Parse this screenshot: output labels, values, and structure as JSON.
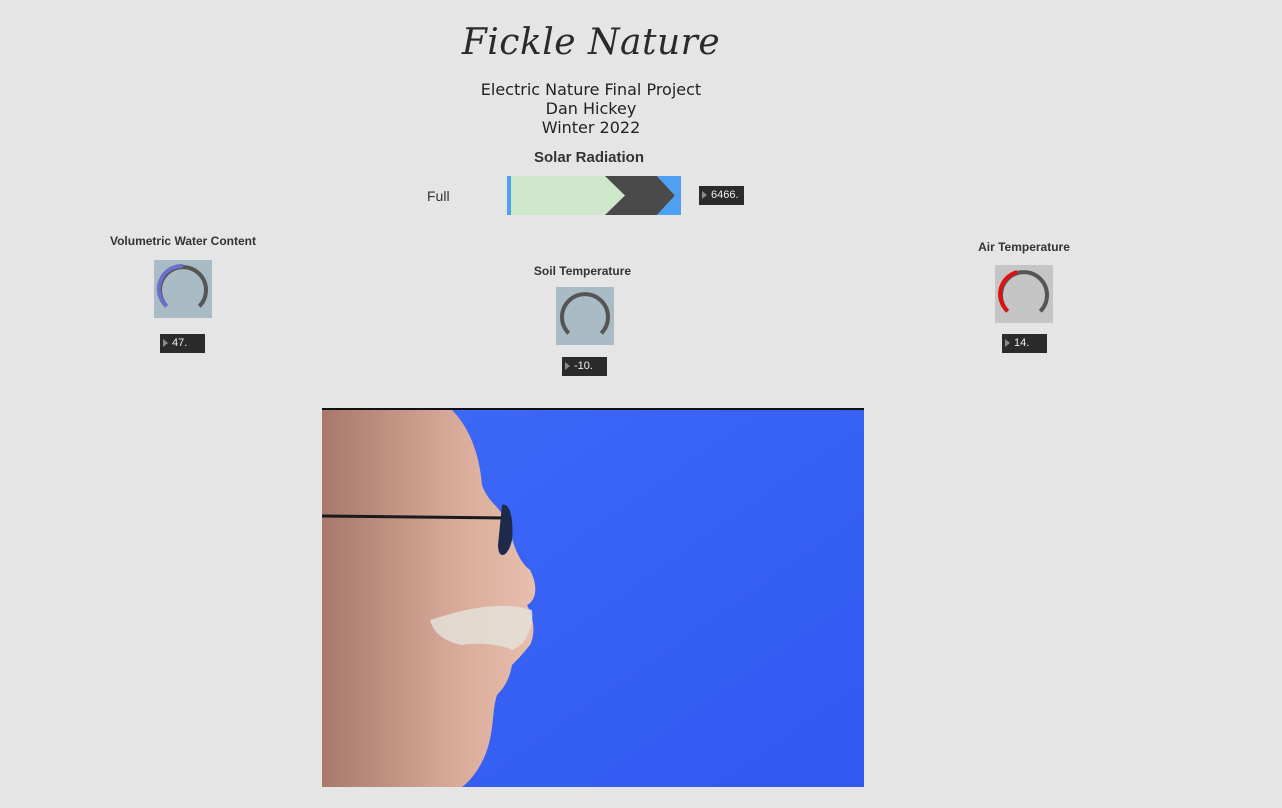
{
  "header": {
    "title": "Fickle Nature",
    "subtitle_lines": [
      "Electric Nature Final Project",
      "Dan Hickey",
      "Winter 2022"
    ]
  },
  "solar": {
    "label": "Solar Radiation",
    "mode_label": "Full",
    "value": "6466."
  },
  "water": {
    "label": "Volumetric Water Content",
    "value": "47.",
    "arc_color": "#6d6fcf"
  },
  "soil": {
    "label": "Soil Temperature",
    "value": "-10."
  },
  "air": {
    "label": "Air Temperature",
    "value": "14.",
    "arc_color": "#e01010"
  },
  "colors": {
    "background": "#e5e5e5",
    "meter_fill": "#cfe8cc",
    "meter_accent": "#4da0f2",
    "meter_arrow": "#4a4a4a",
    "video_bg": "#3a63f5"
  }
}
